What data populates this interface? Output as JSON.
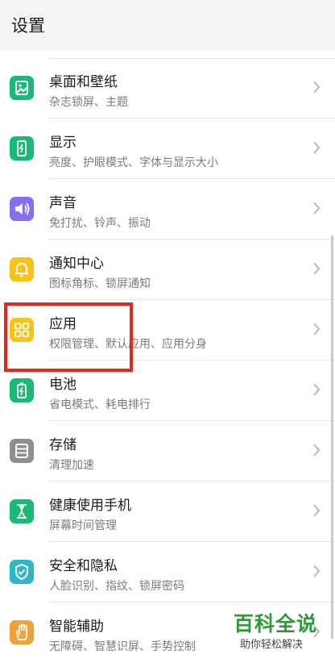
{
  "header": {
    "title": "设置"
  },
  "items": [
    {
      "title": "桌面和壁纸",
      "subtitle": "杂志锁屏、主题",
      "icon": "wallpaper-icon",
      "color": "#19b978"
    },
    {
      "title": "显示",
      "subtitle": "亮度、护眼模式、字体与显示大小",
      "icon": "display-icon",
      "color": "#19b978"
    },
    {
      "title": "声音",
      "subtitle": "免打扰、铃声、振动",
      "icon": "speaker-icon",
      "color": "#8a6cf2"
    },
    {
      "title": "通知中心",
      "subtitle": "图标角标、锁屏通知",
      "icon": "bell-icon",
      "color": "#f7c21a"
    },
    {
      "title": "应用",
      "subtitle": "权限管理、默认应用、应用分身",
      "icon": "apps-grid-icon",
      "color": "#f7c21a"
    },
    {
      "title": "电池",
      "subtitle": "省电模式、耗电排行",
      "icon": "battery-icon",
      "color": "#19b978"
    },
    {
      "title": "存储",
      "subtitle": "清理加速",
      "icon": "storage-icon",
      "color": "#8f8f8f"
    },
    {
      "title": "健康使用手机",
      "subtitle": "屏幕时间管理",
      "icon": "hourglass-icon",
      "color": "#19b978"
    },
    {
      "title": "安全和隐私",
      "subtitle": "人脸识别、指纹、锁屏密码",
      "icon": "shield-icon",
      "color": "#2bb7c9"
    },
    {
      "title": "智能辅助",
      "subtitle": "无障碍、智慧识屏、手势控制",
      "icon": "hand-icon",
      "color": "#f0a23a"
    }
  ],
  "watermark": {
    "main": "百科全说",
    "sub": "助你轻松解决"
  },
  "colors": {
    "highlight": "#e5261f",
    "chevron": "#b8b8b8"
  }
}
